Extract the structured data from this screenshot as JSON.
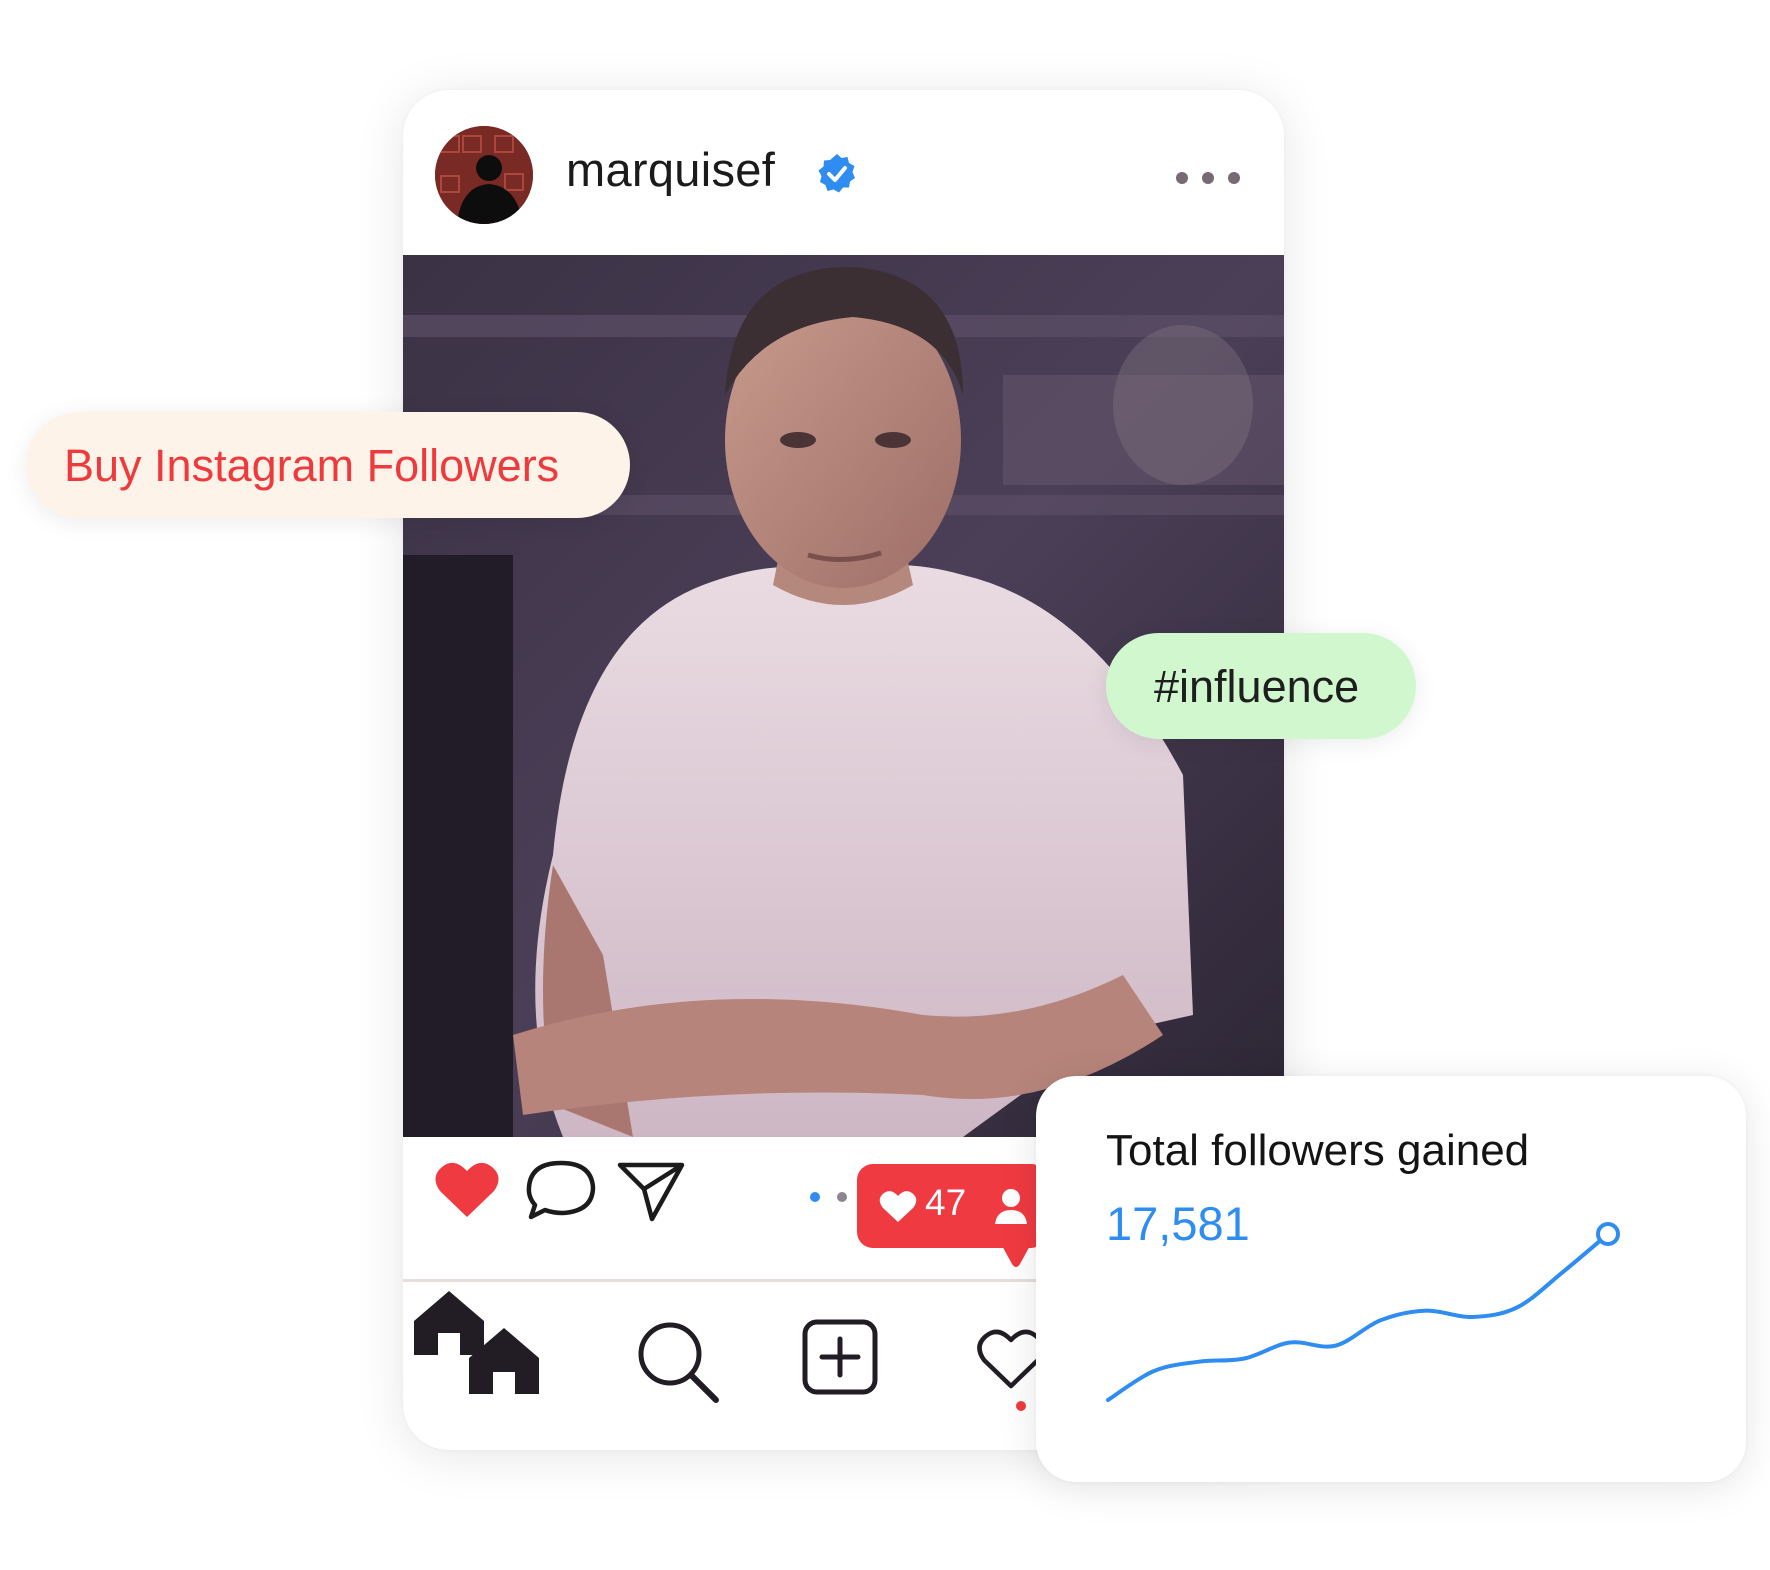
{
  "post": {
    "username": "marquisef",
    "verified": true,
    "menu_icon": "more-horizontal-icon",
    "avatar_icon": "avatar-silhouette",
    "photo_description_icon": "post-photo"
  },
  "actions": {
    "like_icon": "heart-filled-icon",
    "comment_icon": "comment-bubble-icon",
    "share_icon": "paper-plane-icon",
    "like_color": "#f03a41"
  },
  "notification": {
    "likes": "47",
    "heart_icon": "heart-icon",
    "follower_icon": "person-icon",
    "color": "#f03a41"
  },
  "nav": [
    {
      "icon": "home-icon"
    },
    {
      "icon": "search-icon"
    },
    {
      "icon": "add-post-icon"
    },
    {
      "icon": "activity-heart-icon"
    }
  ],
  "pills": {
    "buy": "Buy Instagram Followers",
    "buy_color": "#ee3a3c",
    "hashtag": "#influence"
  },
  "stats": {
    "title": "Total followers gained",
    "value": "17,581",
    "accent": "#2f8cf0"
  },
  "chart_data": {
    "type": "line",
    "title": "",
    "xlabel": "",
    "ylabel": "",
    "grid": false,
    "x": [
      0,
      1,
      2,
      3,
      4,
      5,
      6,
      7,
      8,
      9,
      10,
      11
    ],
    "values": [
      0,
      9,
      12,
      13,
      18,
      17,
      25,
      28,
      26,
      29,
      40,
      52
    ]
  }
}
